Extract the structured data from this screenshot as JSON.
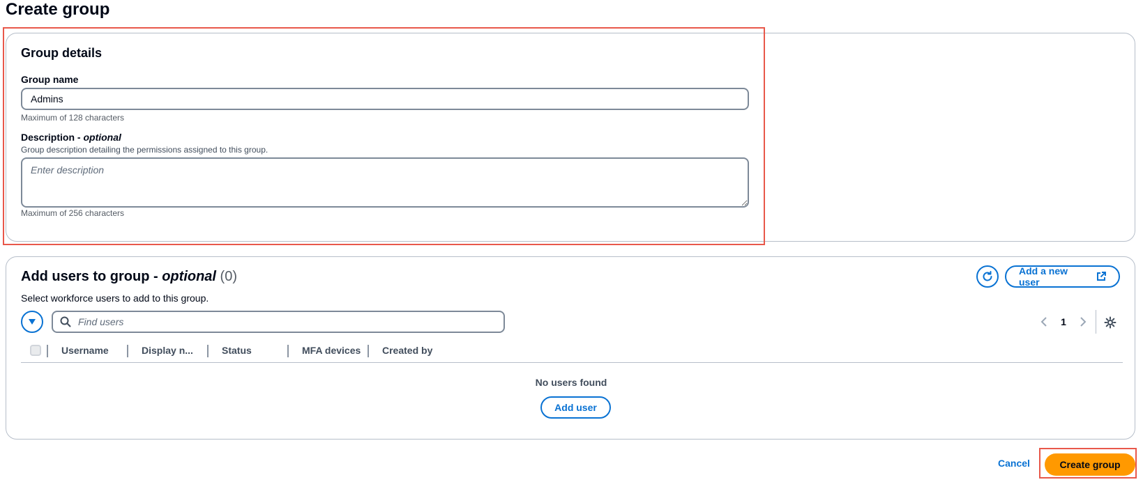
{
  "page": {
    "title": "Create group"
  },
  "group_details": {
    "section_title": "Group details",
    "group_name": {
      "label": "Group name",
      "value": "Admins",
      "hint": "Maximum of 128 characters"
    },
    "description": {
      "label_main": "Description - ",
      "label_optional": "optional",
      "help": "Group description detailing the permissions assigned to this group.",
      "placeholder": "Enter description",
      "value": "",
      "hint": "Maximum of 256 characters"
    }
  },
  "add_users": {
    "title_main": "Add users to group - ",
    "title_optional": "optional",
    "count": "(0)",
    "subtitle": "Select workforce users to add to this group.",
    "refresh_icon": "refresh-icon",
    "add_new_user_label": "Add a new user",
    "external_icon": "external-link-icon",
    "search_placeholder": "Find users",
    "pagination": {
      "current_page": "1"
    },
    "columns": [
      "Username",
      "Display n...",
      "Status",
      "MFA devices",
      "Created by"
    ],
    "empty_title": "No users found",
    "add_user_label": "Add user"
  },
  "footer": {
    "cancel_label": "Cancel",
    "create_label": "Create group"
  },
  "colors": {
    "accent": "#0972d3",
    "primary_button": "#ff9900",
    "highlight": "#e8584a"
  }
}
